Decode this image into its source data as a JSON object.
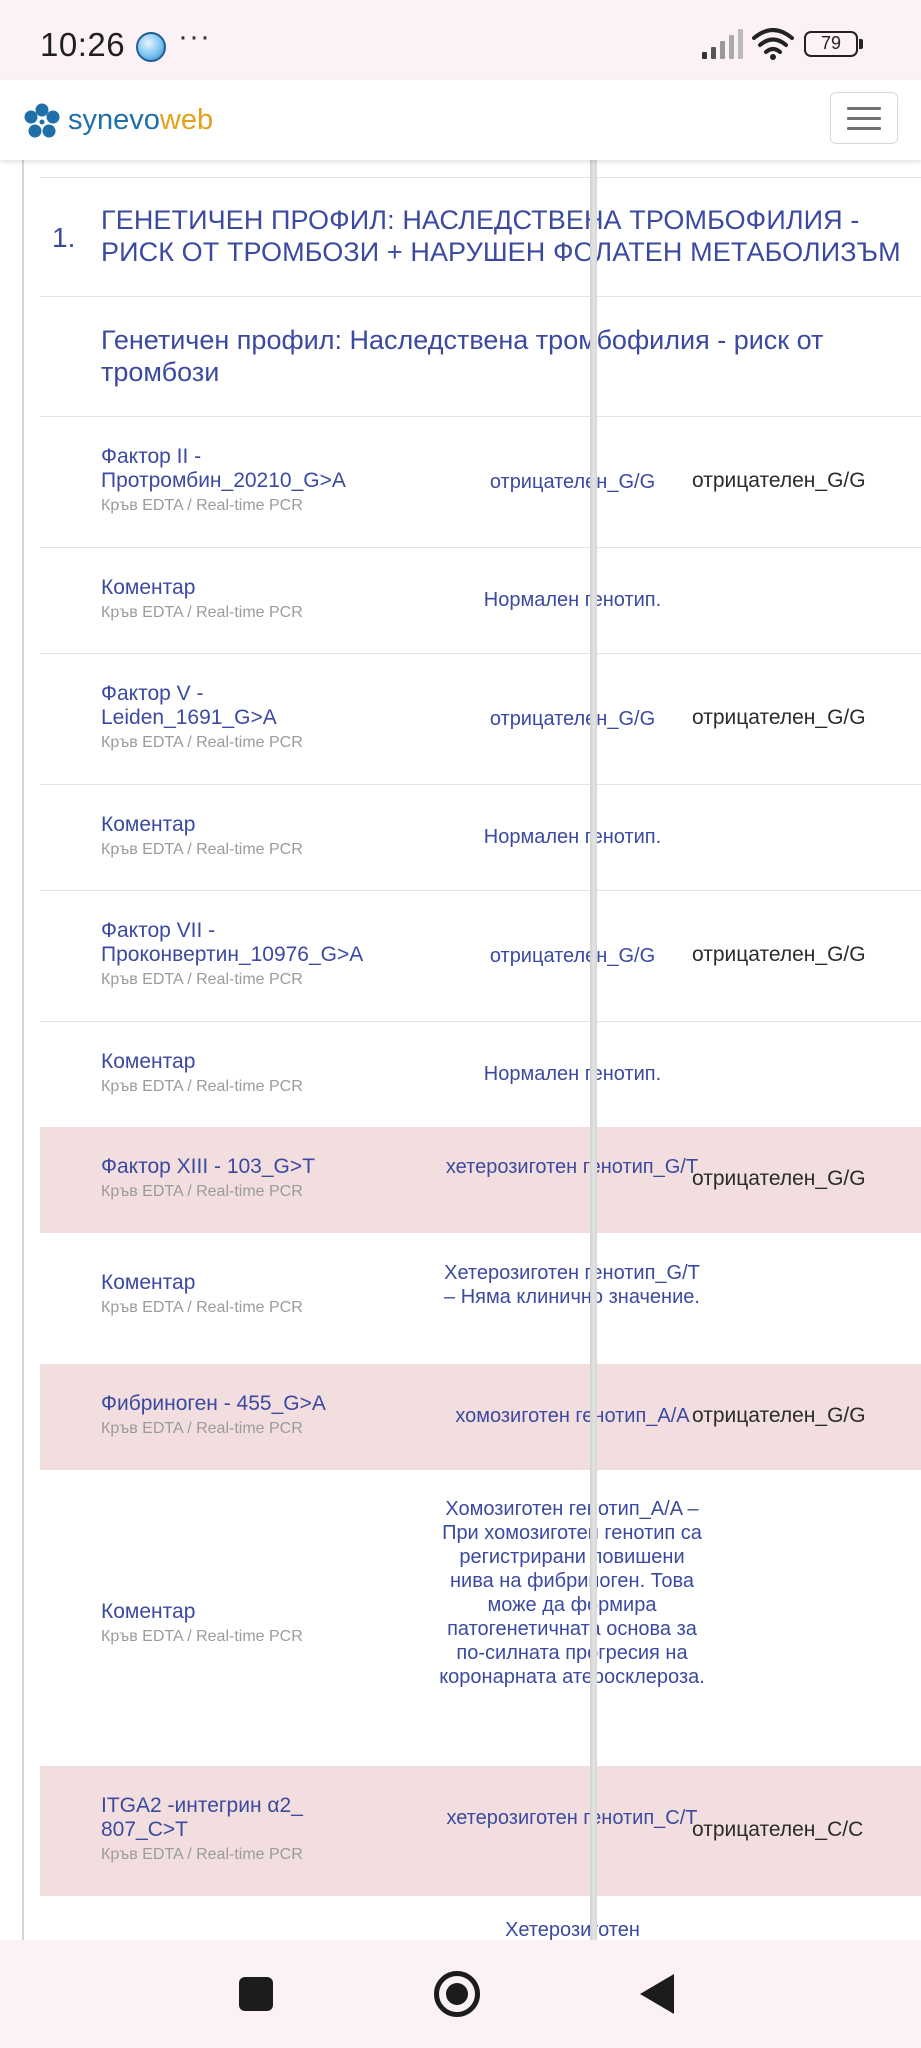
{
  "status_bar": {
    "time": "10:26",
    "more": "···",
    "battery": "79",
    "icons": [
      "app-bubble-icon",
      "signal-icon",
      "wifi-icon",
      "battery-icon"
    ]
  },
  "header": {
    "logo_part1": "synevo",
    "logo_part2": "web",
    "brand_colors": {
      "primary": "#1f6fa8",
      "accent": "#e3a21a"
    },
    "menu_icon": "hamburger-menu-icon"
  },
  "report": {
    "section_number": "1.",
    "section_title": "ГЕНЕТИЧЕН ПРОФИЛ: НАСЛЕДСТВЕНА ТРОМБОФИЛИЯ - РИСК ОТ ТРОМБОЗИ + НАРУШЕН ФОЛАТЕН МЕТАБОЛИЗЪМ",
    "subsection_title": "Генетичен профил: Наследствена тромбофилия - риск от тромбози",
    "highlight_color": "#f2dede",
    "rows": [
      {
        "name": "Фактор II - Протромбин_20210_G>A",
        "sample": "Кръв EDTA / Real-time PCR",
        "result": "отрицателен_G/G",
        "reference": "отрицателен_G/G",
        "highlighted": false
      },
      {
        "name": "Коментар",
        "sample": "Кръв EDTA / Real-time PCR",
        "result": "Нормален генотип.",
        "reference": "",
        "highlighted": false
      },
      {
        "name": "Фактор V - Leiden_1691_G>A",
        "sample": "Кръв EDTA / Real-time PCR",
        "result": "отрицателен_G/G",
        "reference": "отрицателен_G/G",
        "highlighted": false
      },
      {
        "name": "Коментар",
        "sample": "Кръв EDTA / Real-time PCR",
        "result": "Нормален генотип.",
        "reference": "",
        "highlighted": false
      },
      {
        "name": "Фактор VII - Проконвертин_10976_G>A",
        "sample": "Кръв EDTA / Real-time PCR",
        "result": "отрицателен_G/G",
        "reference": "отрицателен_G/G",
        "highlighted": false
      },
      {
        "name": "Коментар",
        "sample": "Кръв EDTA / Real-time PCR",
        "result": "Нормален генотип.",
        "reference": "",
        "highlighted": false
      },
      {
        "name": "Фактор XIII - 103_G>T",
        "sample": "Кръв EDTA / Real-time PCR",
        "result": "хетерозиготен генотип_G/T",
        "reference": "отрицателен_G/G",
        "highlighted": true
      },
      {
        "name": "Коментар",
        "sample": "Кръв EDTA / Real-time PCR",
        "result": "Хетерозиготен генотип_G/T – Няма клинично значение.",
        "reference": "",
        "highlighted": false
      },
      {
        "name": "Фибриноген - 455_G>A",
        "sample": "Кръв EDTA / Real-time PCR",
        "result": "хомозиготен генотип_A/A",
        "reference": "отрицателен_G/G",
        "highlighted": true
      },
      {
        "name": "Коментар",
        "sample": "Кръв EDTA / Real-time PCR",
        "result": "Хомозиготен генотип_A/A – При хомозиготен генотип са регистрирани повишени нива на фибриноген. Това може да формира патогенетичната основа за по-силната прогресия на коронарната атеросклероза.",
        "reference": "",
        "highlighted": false
      },
      {
        "name": "ITGA2 -интегрин α2_ 807_C>T",
        "sample": "Кръв EDTA / Real-time PCR",
        "result": "хетерозиготен генотип_C/T",
        "reference": "отрицателен_C/C",
        "highlighted": true
      },
      {
        "name": "",
        "sample": "",
        "result": "Хетерозиготен",
        "reference": "",
        "highlighted": false
      }
    ]
  },
  "nav_bar": {
    "icons": [
      "recents-square-icon",
      "home-circle-icon",
      "back-triangle-icon"
    ]
  }
}
